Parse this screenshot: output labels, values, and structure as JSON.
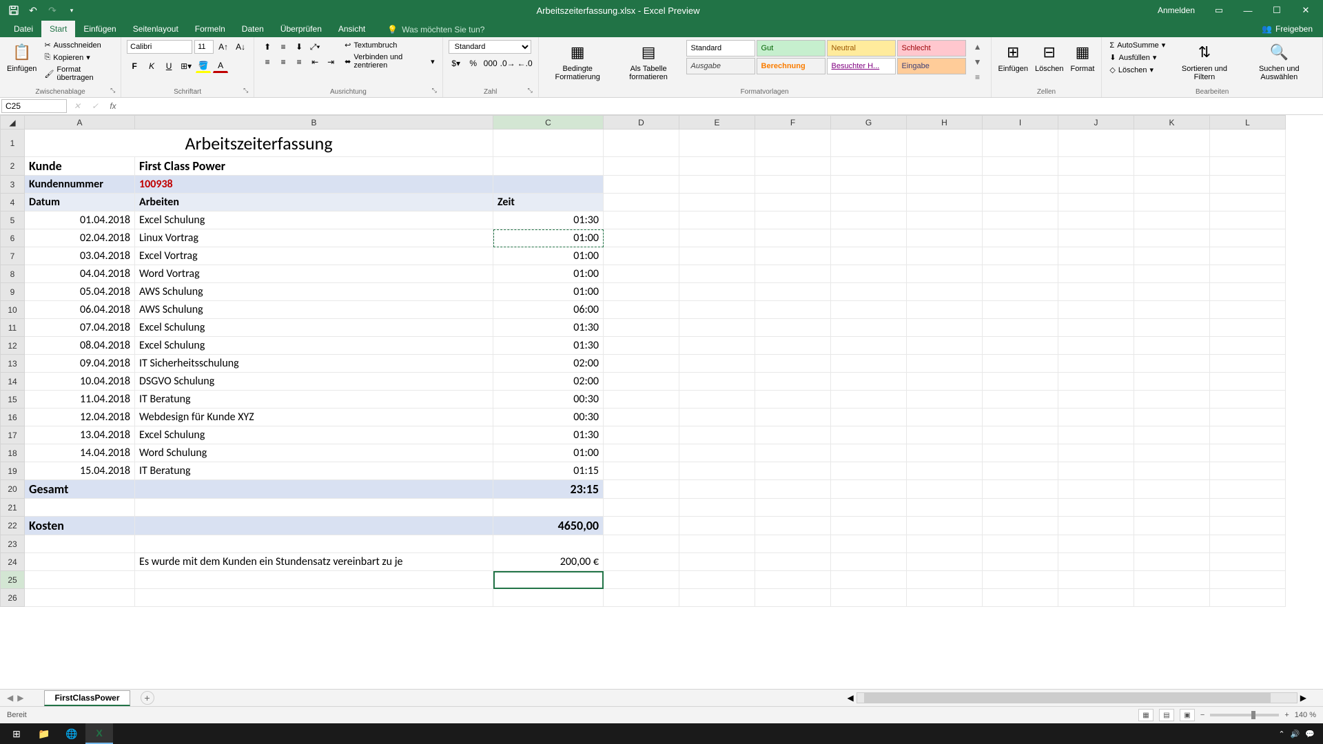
{
  "titlebar": {
    "title": "Arbeitszeiterfassung.xlsx - Excel Preview",
    "anmelden": "Anmelden"
  },
  "tabs": {
    "datei": "Datei",
    "start": "Start",
    "einfuegen": "Einfügen",
    "seitenlayout": "Seitenlayout",
    "formeln": "Formeln",
    "daten": "Daten",
    "ueberpruefen": "Überprüfen",
    "ansicht": "Ansicht",
    "tellme": "Was möchten Sie tun?",
    "freigeben": "Freigeben"
  },
  "ribbon": {
    "clipboard": {
      "paste": "Einfügen",
      "cut": "Ausschneiden",
      "copy": "Kopieren",
      "format": "Format übertragen",
      "group": "Zwischenablage"
    },
    "font": {
      "name": "Calibri",
      "size": "11",
      "group": "Schriftart"
    },
    "align": {
      "wrap": "Textumbruch",
      "merge": "Verbinden und zentrieren",
      "group": "Ausrichtung"
    },
    "number": {
      "format": "Standard",
      "group": "Zahl"
    },
    "styles": {
      "cond": "Bedingte Formatierung",
      "table": "Als Tabelle formatieren",
      "standard": "Standard",
      "gut": "Gut",
      "neutral": "Neutral",
      "schlecht": "Schlecht",
      "ausgabe": "Ausgabe",
      "berechnung": "Berechnung",
      "besucht": "Besuchter H...",
      "eingabe": "Eingabe",
      "group": "Formatvorlagen"
    },
    "cells": {
      "insert": "Einfügen",
      "delete": "Löschen",
      "format": "Format",
      "group": "Zellen"
    },
    "editing": {
      "sum": "AutoSumme",
      "fill": "Ausfüllen",
      "clear": "Löschen",
      "sort": "Sortieren und Filtern",
      "find": "Suchen und Auswählen",
      "group": "Bearbeiten"
    }
  },
  "namebox": "C25",
  "columns": [
    "A",
    "B",
    "C",
    "D",
    "E",
    "F",
    "G",
    "H",
    "I",
    "J",
    "K",
    "L"
  ],
  "rows": {
    "1": {
      "title": "Arbeitszeiterfassung"
    },
    "2": {
      "a": "Kunde",
      "b": "First Class Power"
    },
    "3": {
      "a": "Kundennummer",
      "b": "100938"
    },
    "4": {
      "a": "Datum",
      "b": "Arbeiten",
      "c": "Zeit"
    },
    "5": {
      "a": "01.04.2018",
      "b": "Excel Schulung",
      "c": "01:30"
    },
    "6": {
      "a": "02.04.2018",
      "b": "Linux Vortrag",
      "c": "01:00"
    },
    "7": {
      "a": "03.04.2018",
      "b": "Excel Vortrag",
      "c": "01:00"
    },
    "8": {
      "a": "04.04.2018",
      "b": "Word Vortrag",
      "c": "01:00"
    },
    "9": {
      "a": "05.04.2018",
      "b": "AWS Schulung",
      "c": "01:00"
    },
    "10": {
      "a": "06.04.2018",
      "b": "AWS Schulung",
      "c": "06:00"
    },
    "11": {
      "a": "07.04.2018",
      "b": "Excel Schulung",
      "c": "01:30"
    },
    "12": {
      "a": "08.04.2018",
      "b": "Excel Schulung",
      "c": "01:30"
    },
    "13": {
      "a": "09.04.2018",
      "b": "IT Sicherheitsschulung",
      "c": "02:00"
    },
    "14": {
      "a": "10.04.2018",
      "b": "DSGVO Schulung",
      "c": "02:00"
    },
    "15": {
      "a": "11.04.2018",
      "b": "IT Beratung",
      "c": "00:30"
    },
    "16": {
      "a": "12.04.2018",
      "b": "Webdesign für Kunde XYZ",
      "c": "00:30"
    },
    "17": {
      "a": "13.04.2018",
      "b": "Excel Schulung",
      "c": "01:30"
    },
    "18": {
      "a": "14.04.2018",
      "b": "Word Schulung",
      "c": "01:00"
    },
    "19": {
      "a": "15.04.2018",
      "b": "IT Beratung",
      "c": "01:15"
    },
    "20": {
      "a": "Gesamt",
      "c": "23:15"
    },
    "22": {
      "a": "Kosten",
      "c": "4650,00"
    },
    "24": {
      "b": "Es wurde mit dem Kunden ein Stundensatz vereinbart zu je",
      "c": "200,00 €"
    }
  },
  "sheet": {
    "name": "FirstClassPower"
  },
  "status": {
    "ready": "Bereit",
    "zoom": "140 %"
  }
}
